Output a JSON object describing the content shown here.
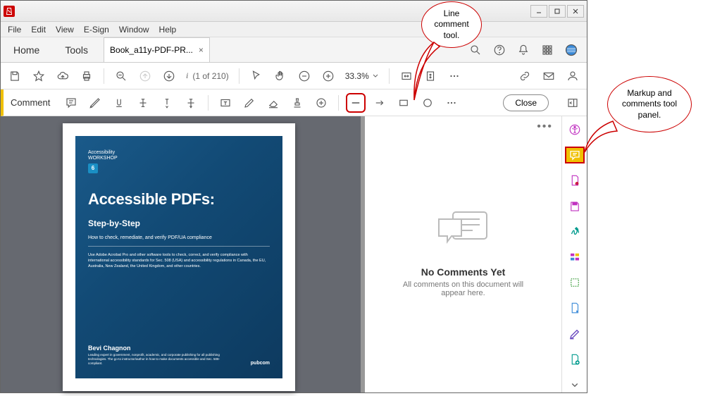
{
  "menubar": {
    "items": [
      "File",
      "Edit",
      "View",
      "E-Sign",
      "Window",
      "Help"
    ]
  },
  "navtabs": {
    "home": "Home",
    "tools": "Tools"
  },
  "doc_tab": {
    "title": "Book_a11y-PDF-PR...",
    "close": "×"
  },
  "viewbar": {
    "page_indicator": "i",
    "page_count": "(1 of 210)",
    "zoom": "33.3%"
  },
  "commentbar": {
    "label": "Comment",
    "close": "Close"
  },
  "cover": {
    "badge_line1": "Accessibility",
    "badge_line2": "WORKSHOP",
    "badge_num": "6",
    "title": "Accessible PDFs:",
    "subtitle": "Step-by-Step",
    "subtitle2": "How to check, remediate, and verify PDF/UA compliance",
    "desc": "Use Adobe Acrobat Pro and other software tools to check, correct, and verify compliance with international accessibility standards for Sec. 508 (USA) and accessibility regulations in Canada, the EU, Australia, New Zealand, the United Kingdom, and other countries.",
    "author": "Bevi Chagnon",
    "author_desc": "Leading expert in government, nonprofit, academic, and corporate publishing for all publishing technologies. The go-to instructor/author in how to make documents accessible and Sec. 508-compliant.",
    "pub": "pubcom"
  },
  "comments_panel": {
    "title": "No Comments Yet",
    "desc": "All comments on this document will appear here."
  },
  "annotations": {
    "line_tool": "Line comment tool.",
    "markup_panel": "Markup and comments tool panel."
  }
}
